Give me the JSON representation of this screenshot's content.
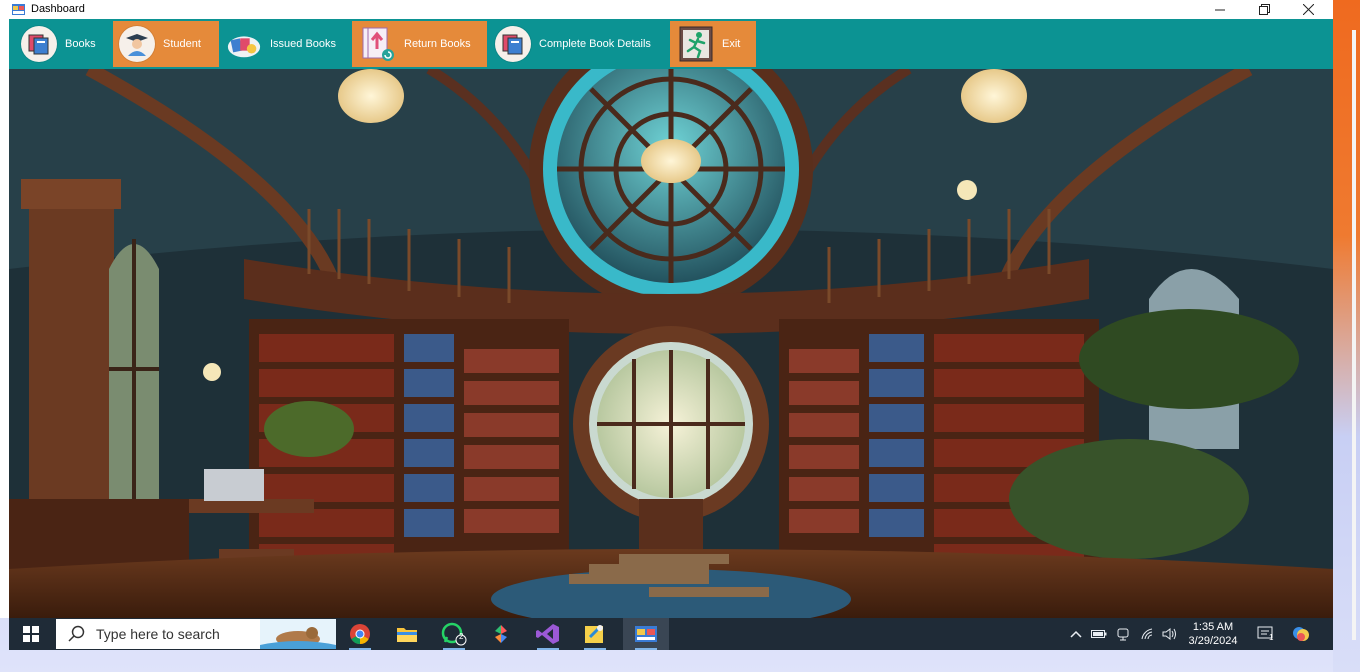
{
  "window": {
    "title": "Dashboard",
    "controls": {
      "minimize": "minimize",
      "restore": "restore",
      "close": "close"
    }
  },
  "toolbar": {
    "items": [
      {
        "label": "Books",
        "icon": "books-icon",
        "active": false
      },
      {
        "label": "Student",
        "icon": "student-icon",
        "active": true
      },
      {
        "label": "Issued Books",
        "icon": "issued-books-icon",
        "active": false
      },
      {
        "label": "Return Books",
        "icon": "return-books-icon",
        "active": true
      },
      {
        "label": "Complete Book Details",
        "icon": "book-details-icon",
        "active": false
      },
      {
        "label": "Exit",
        "icon": "exit-icon",
        "active": true
      }
    ],
    "color": "#0c9393",
    "active_color": "#e58a3a"
  },
  "taskbar": {
    "search_placeholder": "Type here to search",
    "apps": [
      {
        "name": "chrome",
        "badge": ""
      },
      {
        "name": "file-explorer",
        "badge": ""
      },
      {
        "name": "whatsapp",
        "badge": "2"
      },
      {
        "name": "pinwheel-app",
        "badge": ""
      },
      {
        "name": "visual-studio",
        "badge": ""
      },
      {
        "name": "sticky-app",
        "badge": ""
      },
      {
        "name": "dashboard-app",
        "badge": ""
      }
    ],
    "clock": {
      "time": "1:35 AM",
      "date": "3/29/2024"
    },
    "notification_badge": "1"
  }
}
